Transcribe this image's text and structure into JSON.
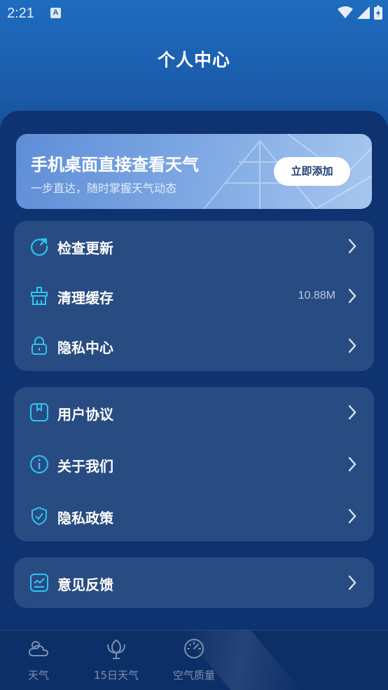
{
  "status": {
    "time": "2:21",
    "notification": "A"
  },
  "header": {
    "title": "个人中心"
  },
  "banner": {
    "title": "手机桌面直接查看天气",
    "subtitle": "一步直达，随时掌握天气动态",
    "button": "立即添加"
  },
  "groups": [
    {
      "items": [
        {
          "icon": "refresh-icon",
          "label": "检查更新",
          "value": ""
        },
        {
          "icon": "broom-icon",
          "label": "清理缓存",
          "value": "10.88M"
        },
        {
          "icon": "lock-icon",
          "label": "隐私中心",
          "value": ""
        }
      ]
    },
    {
      "items": [
        {
          "icon": "bookmark-icon",
          "label": "用户协议"
        },
        {
          "icon": "info-icon",
          "label": "关于我们"
        },
        {
          "icon": "shield-icon",
          "label": "隐私政策"
        }
      ]
    },
    {
      "items": [
        {
          "icon": "feedback-icon",
          "label": "意见反馈"
        }
      ]
    }
  ],
  "tabs": [
    {
      "icon": "weather-icon",
      "label": "天气"
    },
    {
      "icon": "calendar-15day-icon",
      "label": "15日天气"
    },
    {
      "icon": "air-quality-icon",
      "label": "空气质量"
    }
  ],
  "colors": {
    "accent": "#2ec4f0",
    "card": "#284c82",
    "panel": "#0e3370"
  }
}
